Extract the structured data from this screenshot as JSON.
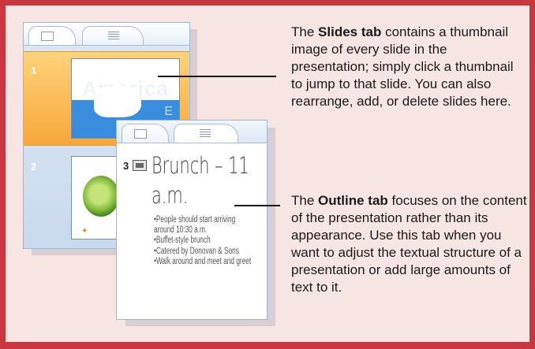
{
  "slides_pane": {
    "tabs": [
      {
        "name": "slides-tab",
        "icon": "slides-tab-icon"
      },
      {
        "name": "outline-tab",
        "icon": "outline-tab-icon"
      }
    ],
    "slides": [
      {
        "number": "1",
        "title": "America",
        "subtitle": "E",
        "selected": true
      },
      {
        "number": "2",
        "selected": false
      }
    ]
  },
  "outline_pane": {
    "slide_number": "3",
    "title": "Brunch – 11 a.m.",
    "bullets": [
      "•People should start arriving around 10:30 a.m.",
      "•Buffet-style brunch",
      "•Catered by Donovan & Sons",
      "•Walk around and meet and greet"
    ]
  },
  "callouts": {
    "slides": {
      "bold": "Slides tab",
      "before": "The ",
      "after": " contains a thumbnail image of every slide in the presentation; simply click a thumbnail to jump to that slide. You can also rearrange, add, or delete slides here."
    },
    "outline": {
      "bold": "Outline tab",
      "before": "The ",
      "after": " focuses on the content of the presentation rather than its appearance. Use this tab when you want to adjust the textual structure of a presentation or add large amounts of text to it."
    }
  },
  "colors": {
    "frame_border": "#c8373f",
    "frame_fill": "#f7e5e3",
    "selected_slide": "#f6a83b",
    "thumbnail_blue": "#3a8ddd"
  }
}
